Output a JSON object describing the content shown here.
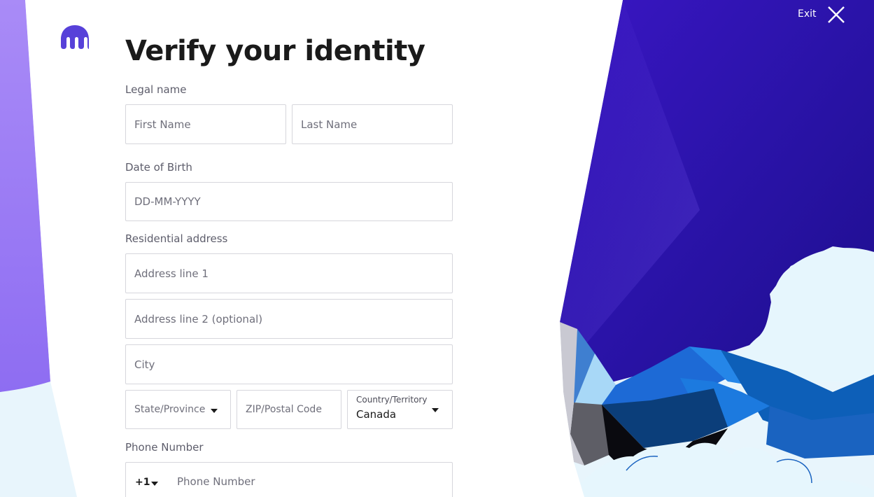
{
  "header": {
    "title": "Verify your identity",
    "exit_label": "Exit"
  },
  "logo": {
    "icon": "kraken-logo-icon",
    "color": "#5741d9"
  },
  "close": {
    "icon": "close-icon"
  },
  "sections": {
    "legal_name": "Legal name",
    "dob": "Date of Birth",
    "address": "Residential address",
    "phone": "Phone Number"
  },
  "fields": {
    "first_name": {
      "placeholder": "First Name"
    },
    "last_name": {
      "placeholder": "Last Name"
    },
    "dob": {
      "placeholder": "DD-MM-YYYY"
    },
    "address1": {
      "placeholder": "Address line 1"
    },
    "address2": {
      "placeholder": "Address line 2 (optional)"
    },
    "city": {
      "placeholder": "City"
    },
    "state": {
      "placeholder": "State/Province"
    },
    "zip": {
      "placeholder": "ZIP/Postal Code"
    },
    "country": {
      "label": "Country/Territory",
      "value": "Canada"
    },
    "phone_code": {
      "value": "+1"
    },
    "phone": {
      "placeholder": "Phone Number"
    }
  },
  "colors": {
    "brand": "#5741d9",
    "gradient_dark": "#2a0fa8",
    "gradient_light": "#7a5cf0",
    "cloud": "#e6f6fd"
  }
}
